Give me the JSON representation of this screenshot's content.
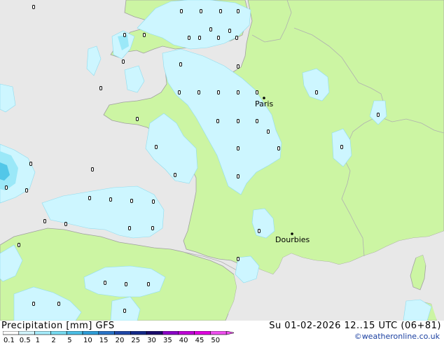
{
  "map": {
    "colors": {
      "sea": "#e8e8e8",
      "land": "#ccf5a3",
      "rain": "#cdf6ff",
      "rain_medium": "#9be8f8",
      "rain_heavy": "#52c7e8",
      "coast": "#a0a0a0",
      "border": "#b0b0b0"
    },
    "cities": [
      {
        "name": "Paris",
        "lon": 2.35,
        "lat": 48.86
      },
      {
        "name": "Dourbies",
        "lon": 3.45,
        "lat": 44.07
      }
    ]
  },
  "footer": {
    "title": "Precipitation [mm]  GFS",
    "datetime": "Su 01-02-2026 12..15 UTC (06+81)",
    "credit": "©weatheronline.co.uk",
    "scale": [
      {
        "label": "0.1",
        "color": "#ffffff"
      },
      {
        "label": "0.5",
        "color": "#d4f6ff"
      },
      {
        "label": "1",
        "color": "#a6ecfb"
      },
      {
        "label": "2",
        "color": "#78dcf2"
      },
      {
        "label": "5",
        "color": "#4cbfe6"
      },
      {
        "label": "10",
        "color": "#2f9ed8"
      },
      {
        "label": "15",
        "color": "#2a74c8"
      },
      {
        "label": "20",
        "color": "#2048a8"
      },
      {
        "label": "25",
        "color": "#142a8a"
      },
      {
        "label": "30",
        "color": "#1a0c6c"
      },
      {
        "label": "35",
        "color": "#8c00c8"
      },
      {
        "label": "40",
        "color": "#c000d8"
      },
      {
        "label": "45",
        "color": "#e000e0"
      },
      {
        "label": "50",
        "color": "#f050f0"
      }
    ]
  }
}
